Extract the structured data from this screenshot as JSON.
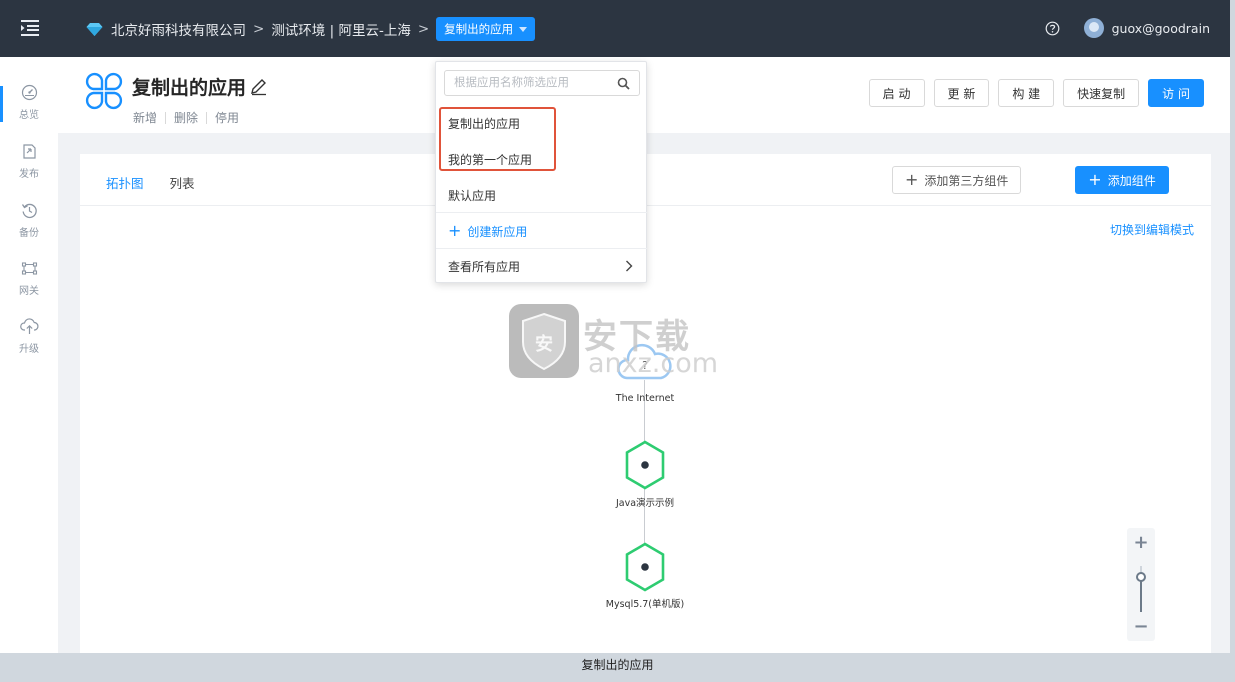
{
  "topbar": {
    "breadcrumb": [
      "北京好雨科技有限公司",
      "测试环境 | 阿里云-上海"
    ],
    "separator": ">",
    "current_app": "复制出的应用",
    "username": "guox@goodrain"
  },
  "sidebar": {
    "items": [
      {
        "label": "总览",
        "icon": "dashboard-icon"
      },
      {
        "label": "发布",
        "icon": "publish-icon"
      },
      {
        "label": "备份",
        "icon": "backup-icon"
      },
      {
        "label": "网关",
        "icon": "gateway-icon"
      },
      {
        "label": "升级",
        "icon": "upgrade-icon"
      }
    ]
  },
  "app": {
    "title": "复制出的应用",
    "actions": [
      "新增",
      "删除",
      "停用"
    ],
    "buttons": [
      "启 动",
      "更 新",
      "构 建",
      "快速复制",
      "访 问"
    ]
  },
  "card": {
    "tabs": [
      "拓扑图",
      "列表"
    ],
    "add_third_party": "添加第三方组件",
    "add_component": "添加组件",
    "edit_mode": "切换到编辑模式"
  },
  "topology": {
    "nodes": [
      {
        "label": "The Internet",
        "type": "cloud"
      },
      {
        "label": "Java演示示例",
        "type": "service"
      },
      {
        "label": "Mysql5.7(单机版)",
        "type": "service"
      }
    ]
  },
  "zoom": {
    "plus": "+",
    "minus": "−"
  },
  "dropdown": {
    "search_placeholder": "根据应用名称筛选应用",
    "apps": [
      "复制出的应用",
      "我的第一个应用",
      "默认应用"
    ],
    "create": "创建新应用",
    "view_all": "查看所有应用"
  },
  "watermark": {
    "text": "安下载",
    "sub": "anxz.com",
    "badge": "安"
  },
  "caption": "复制出的应用",
  "colors": {
    "accent": "#1890ff",
    "topbar": "#2c3541",
    "node_green": "#2ecc71",
    "highlight_red": "#e0533a"
  }
}
